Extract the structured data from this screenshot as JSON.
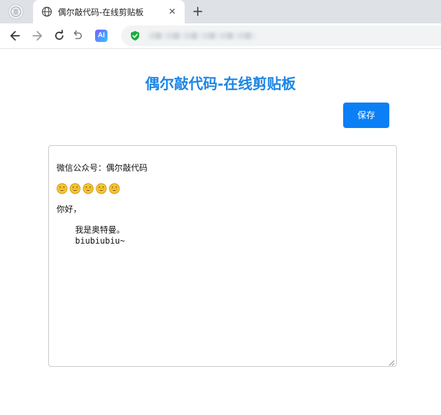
{
  "browser": {
    "tab_title": "偶尔敲代码-在线剪贴板",
    "tab_close": "✕",
    "new_tab": "+",
    "ai_label": "AI",
    "accent_color": "#1aad3e"
  },
  "page": {
    "title": "偶尔敲代码-在线剪贴板",
    "title_color": "#1c86e6",
    "save_label": "保存",
    "save_color": "#0b7ff5"
  },
  "editor": {
    "line1": "微信公众号：偶尔敲代码",
    "emoji_count": 5,
    "line3": "你好，",
    "line4": "我是奥特曼。",
    "line5": "biubiubiu~"
  },
  "icons": [
    "browser-logo-icon",
    "globe-icon",
    "close-icon",
    "plus-icon",
    "back-arrow-icon",
    "forward-arrow-icon",
    "reload-icon",
    "undo-icon",
    "shield-icon",
    "smile-emoji-icon",
    "resize-grip-icon"
  ]
}
